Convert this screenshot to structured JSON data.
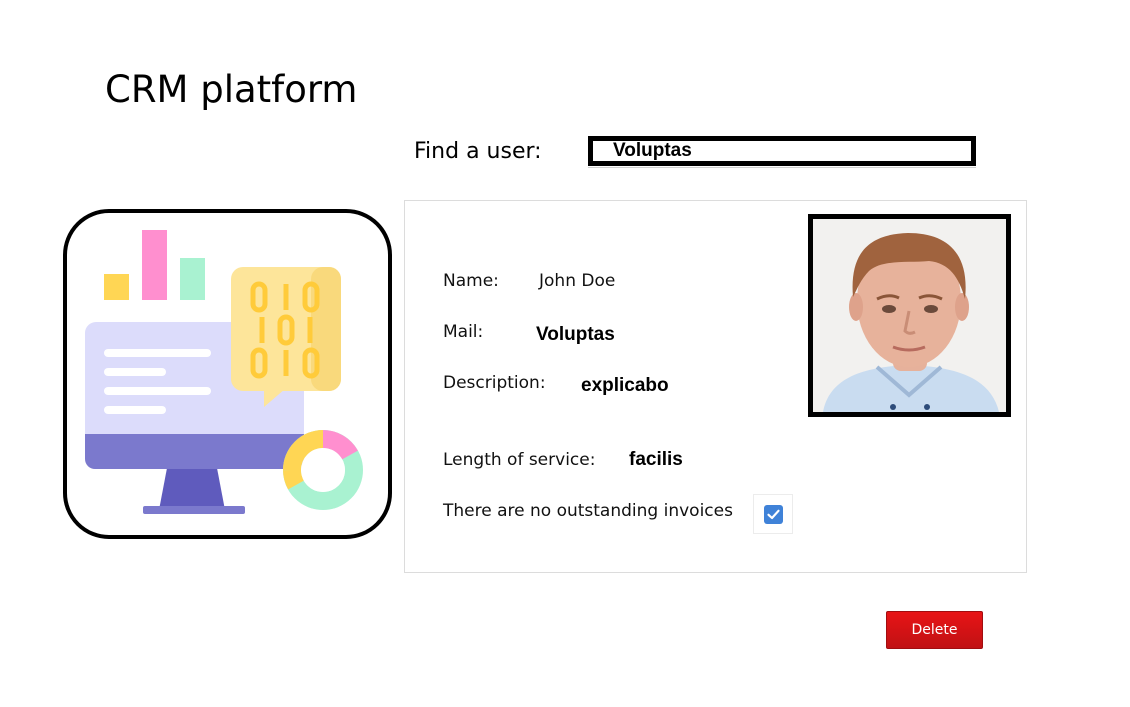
{
  "app": {
    "title": "CRM platform"
  },
  "search": {
    "label": "Find a user:",
    "value": "Voluptas"
  },
  "illustration": {
    "icon": "crm-dashboard-illustration",
    "binary_rows": [
      "010",
      "101",
      "010"
    ]
  },
  "user": {
    "name_label": "Name:",
    "name_value": "John Doe",
    "mail_label": "Mail:",
    "mail_value": "Voluptas",
    "description_label": "Description:",
    "description_value": "explicabo",
    "service_label": "Length of service:",
    "service_value": "facilis",
    "invoices_label": "There are no outstanding invoices",
    "invoices_checked": true,
    "photo_icon": "user-photo"
  },
  "actions": {
    "delete_label": "Delete"
  },
  "colors": {
    "delete_button": "#d91214",
    "checkbox": "#3f82d8",
    "monitor_screen": "#dcdcfb",
    "monitor_base": "#7b79cd",
    "chat_bubble": "#fde59a",
    "bar_yellow": "#ffd654",
    "bar_pink": "#ff8fcf",
    "bar_mint": "#a9f2d1"
  }
}
